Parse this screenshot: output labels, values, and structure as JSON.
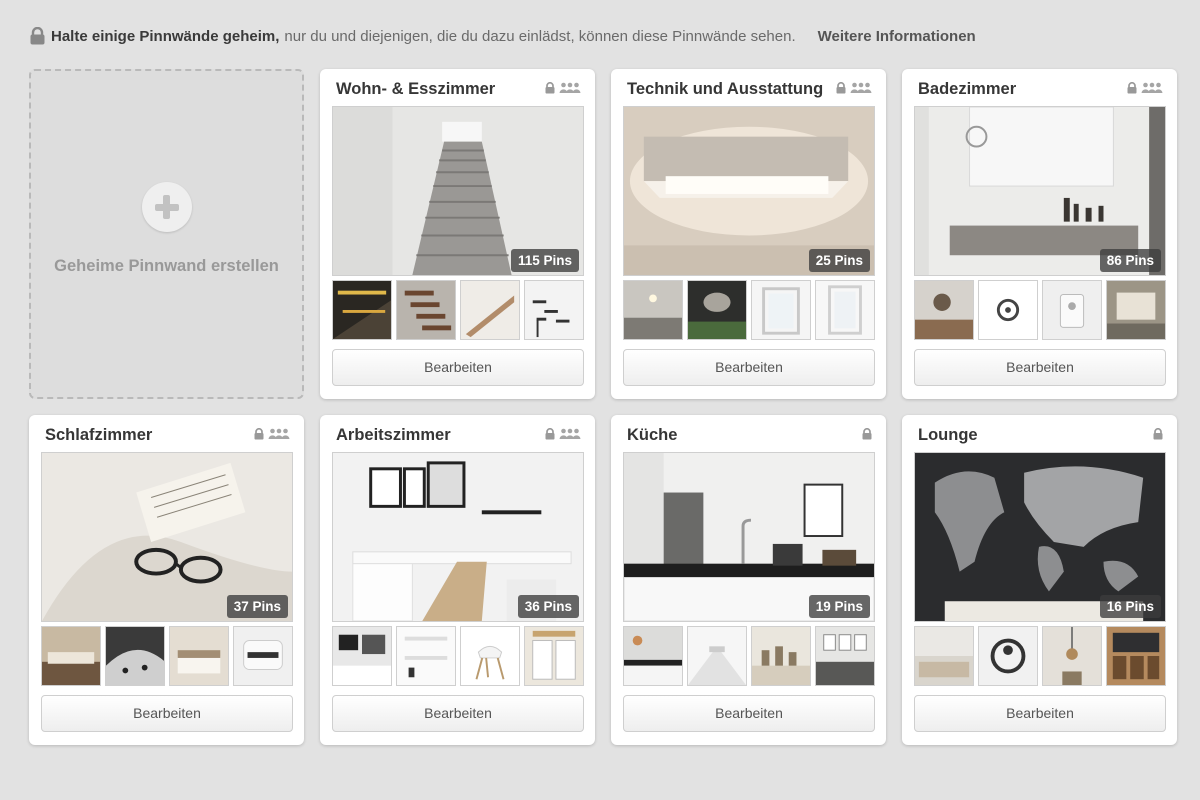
{
  "notice": {
    "bold": "Halte einige Pinnwände geheim,",
    "text": "nur du und diejenigen, die du dazu einlädst, können diese Pinnwände sehen.",
    "link": "Weitere Informationen"
  },
  "create": {
    "label": "Geheime Pinnwand erstellen"
  },
  "edit_label": "Bearbeiten",
  "boards": [
    {
      "title": "Wohn- & Esszimmer",
      "pins": "115 Pins",
      "group": true
    },
    {
      "title": "Technik und Ausstattung",
      "pins": "25 Pins",
      "group": true
    },
    {
      "title": "Badezimmer",
      "pins": "86 Pins",
      "group": true
    },
    {
      "title": "Schlafzimmer",
      "pins": "37 Pins",
      "group": true
    },
    {
      "title": "Arbeitszimmer",
      "pins": "36 Pins",
      "group": true
    },
    {
      "title": "Küche",
      "pins": "19 Pins",
      "group": false
    },
    {
      "title": "Lounge",
      "pins": "16 Pins",
      "group": false
    }
  ],
  "icons": {
    "lock": "lock-icon",
    "group": "group-icon",
    "plus": "plus-icon"
  },
  "colors": {
    "background": "#e2e2e2",
    "card": "#ffffff",
    "badge": "#3c3c3c"
  }
}
